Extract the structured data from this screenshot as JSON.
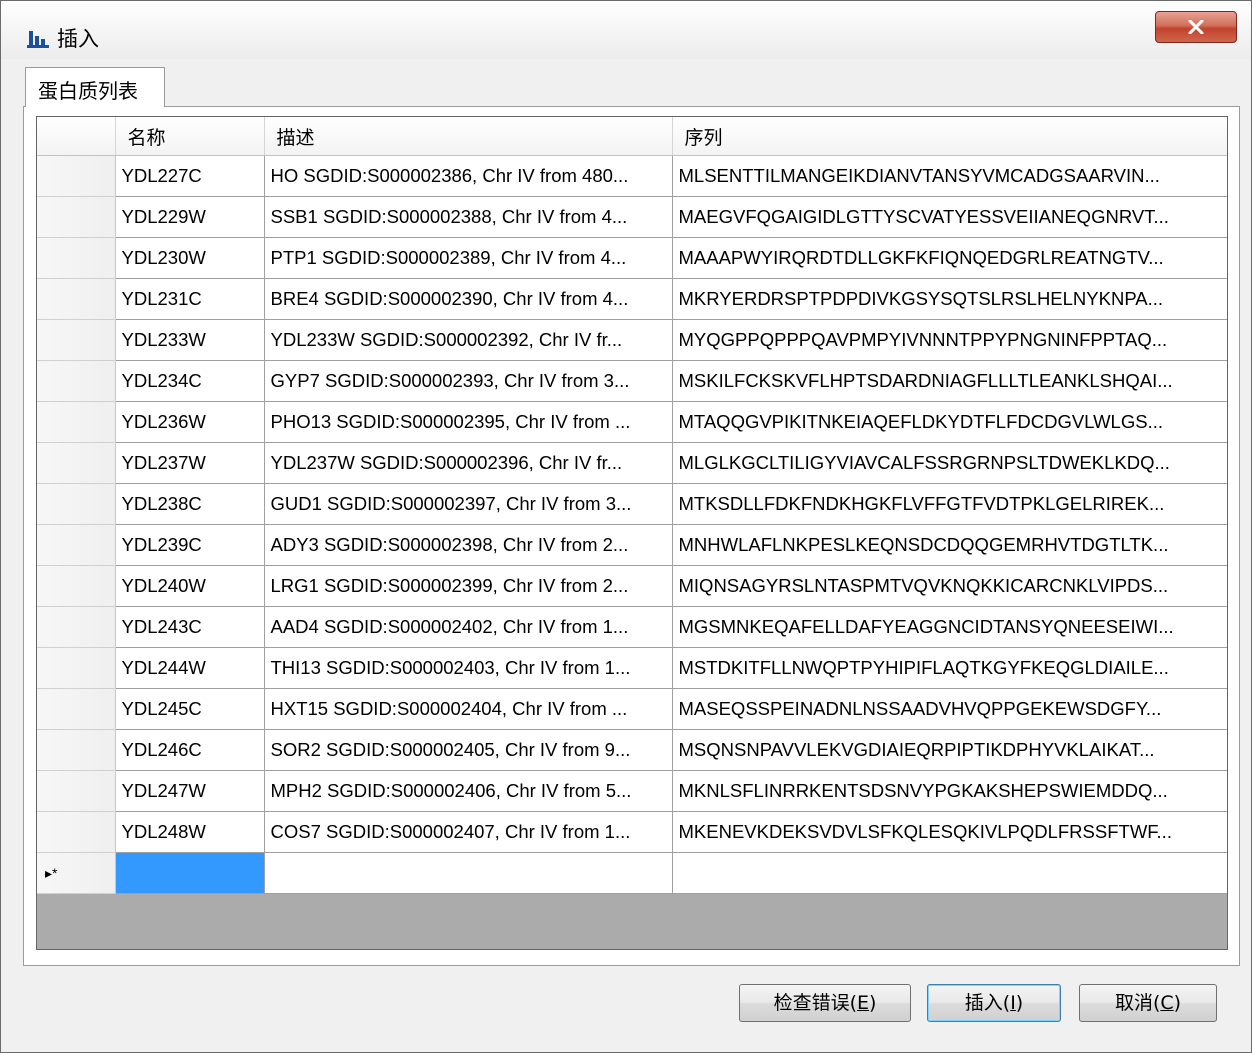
{
  "window": {
    "title": "插入",
    "app_icon": "chart-bar-icon",
    "close_icon": "close-x-icon"
  },
  "tabs": [
    {
      "label": "蛋白质列表"
    }
  ],
  "grid": {
    "columns": [
      "名称",
      "描述",
      "序列"
    ],
    "new_row_marker": "▸*",
    "rows": [
      [
        "YDL227C",
        "HO SGDID:S000002386, Chr IV from 480...",
        "MLSENTTILMANGEIKDIANVTANSYVMCADGSAARVIN..."
      ],
      [
        "YDL229W",
        "SSB1 SGDID:S000002388, Chr IV from 4...",
        "MAEGVFQGAIGIDLGTTYSCVATYESSVEIIANEQGNRVT..."
      ],
      [
        "YDL230W",
        "PTP1 SGDID:S000002389, Chr IV from 4...",
        "MAAAPWYIRQRDTDLLGKFKFIQNQEDGRLREATNGTV..."
      ],
      [
        "YDL231C",
        "BRE4 SGDID:S000002390, Chr IV from 4...",
        "MKRYERDRSPTPDPDIVKGSYSQTSLRSLHELNYKNPA..."
      ],
      [
        "YDL233W",
        "YDL233W SGDID:S000002392, Chr IV fr...",
        "MYQGPPQPPPQAVPMPYIVNNNTPPYPNGNINFPPTAQ..."
      ],
      [
        "YDL234C",
        "GYP7 SGDID:S000002393, Chr IV from 3...",
        "MSKILFCKSKVFLHPTSDARDNIAGFLLLTLEANKLSHQAI..."
      ],
      [
        "YDL236W",
        "PHO13 SGDID:S000002395, Chr IV from ...",
        "MTAQQGVPIKITNKEIAQEFLDKYDTFLFDCDGVLWLGS..."
      ],
      [
        "YDL237W",
        "YDL237W SGDID:S000002396, Chr IV fr...",
        "MLGLKGCLTILIGYVIAVCALFSSRGRNPSLTDWEKLKDQ..."
      ],
      [
        "YDL238C",
        "GUD1 SGDID:S000002397, Chr IV from 3...",
        "MTKSDLLFDKFNDKHGKFLVFFGTFVDTPKLGELRIREK..."
      ],
      [
        "YDL239C",
        "ADY3 SGDID:S000002398, Chr IV from 2...",
        "MNHWLAFLNKPESLKEQNSDCDQQGEMRHVTDGTLTK..."
      ],
      [
        "YDL240W",
        "LRG1 SGDID:S000002399, Chr IV from 2...",
        "MIQNSAGYRSLNTASPMTVQVKNQKKICARCNKLVIPDS..."
      ],
      [
        "YDL243C",
        "AAD4 SGDID:S000002402, Chr IV from 1...",
        "MGSMNKEQAFELLDAFYEAGGNCIDTANSYQNEESEIWI..."
      ],
      [
        "YDL244W",
        "THI13 SGDID:S000002403, Chr IV from 1...",
        "MSTDKITFLLNWQPTPYHIPIFLAQTKGYFKEQGLDIAILE..."
      ],
      [
        "YDL245C",
        "HXT15 SGDID:S000002404, Chr IV from ...",
        "MASEQSSPEINADNLNSSAADVHVQPPGEKEWSDGFY..."
      ],
      [
        "YDL246C",
        "SOR2 SGDID:S000002405, Chr IV from 9...",
        "MSQNSNPAVVLEKVGDIAIEQRPIPTIKDPHYVKLAIKAT..."
      ],
      [
        "YDL247W",
        "MPH2 SGDID:S000002406, Chr IV from 5...",
        "MKNLSFLINRRKENTSDSNVYPGKAKSHEPSWIEMDDQ..."
      ],
      [
        "YDL248W",
        "COS7 SGDID:S000002407, Chr IV from 1...",
        "MKENEVKDEKSVDVLSFKQLESQKIVLPQDLFRSSFTWF..."
      ]
    ]
  },
  "buttons": {
    "check": {
      "label": "检查错误(",
      "mnemonic": "E",
      "suffix": ")"
    },
    "insert": {
      "label": "插入(",
      "mnemonic": "I",
      "suffix": ")"
    },
    "cancel": {
      "label": "取消(",
      "mnemonic": "C",
      "suffix": ")"
    }
  },
  "colors": {
    "selection": "#3399ff",
    "grid_background": "#ababab",
    "close_button": "#c2432c"
  }
}
